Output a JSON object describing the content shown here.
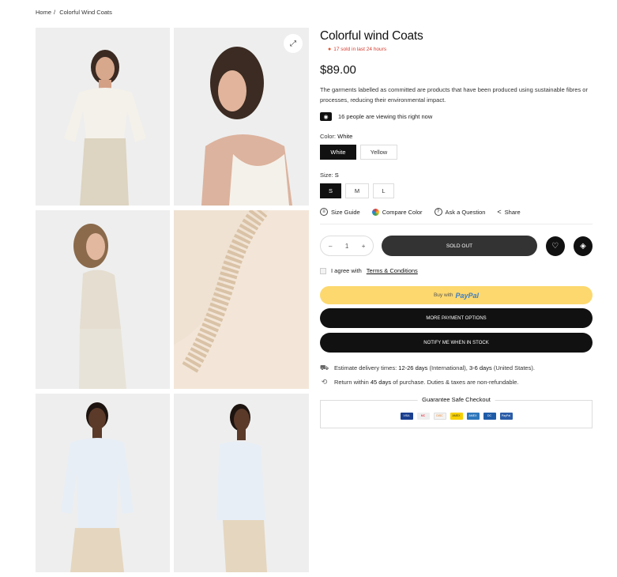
{
  "breadcrumb": {
    "home": "Home",
    "sep": "/",
    "current": "Colorful Wind Coats"
  },
  "product": {
    "title": "Colorful wind Coats",
    "sold_text": "17 sold in last 24 hours",
    "price": "$89.00",
    "description": "The garments labelled as committed are products that have been produced using sustainable fibres or processes, reducing their environmental impact.",
    "viewing_text": "16 people are viewing this right now"
  },
  "color": {
    "label": "Color:",
    "selected": "White",
    "options": [
      "White",
      "Yellow"
    ]
  },
  "size": {
    "label": "Size:",
    "selected": "S",
    "options": [
      "S",
      "M",
      "L"
    ]
  },
  "tools": [
    "Size Guide",
    "Compare Color",
    "Ask a Question",
    "Share"
  ],
  "purchase": {
    "qty_minus": "–",
    "qty_value": "1",
    "qty_plus": "+",
    "sold_out_label": "SOLD OUT",
    "agree_text": "I agree with",
    "terms_link": "Terms & Conditions",
    "paypal_prefix": "Buy with",
    "paypal_brand": "PayPal",
    "more_payment": "MORE PAYMENT OPTIONS",
    "notify": "NOTIFY ME WHEN IN STOCK"
  },
  "shipping": {
    "delivery_prefix": "Estimate delivery times:",
    "delivery_intl": "12-26 days",
    "delivery_intl_suffix": "(International),",
    "delivery_us": "3-6 days",
    "delivery_us_suffix": "(United States).",
    "return_prefix": "Return within",
    "return_days": "45 days",
    "return_suffix": "of purchase. Duties & taxes are non-refundable."
  },
  "checkout": {
    "title": "Guarantee Safe Checkout",
    "cards": [
      {
        "name": "VISA",
        "color": "#1a3f8f"
      },
      {
        "name": "MC",
        "color": "#eb001b"
      },
      {
        "name": "DISC",
        "color": "#f3f3f3"
      },
      {
        "name": "AMEX",
        "color": "#f7d000"
      },
      {
        "name": "AMEX",
        "color": "#2e77bb"
      },
      {
        "name": "DC",
        "color": "#1f5ca8"
      },
      {
        "name": "PayPal",
        "color": "#2b5da8"
      }
    ]
  },
  "icons": {
    "zoom": "expand-icon",
    "fire": "fire-icon",
    "eye": "eye-icon",
    "ruler": "ruler-icon",
    "palette": "color-wheel-icon",
    "question": "question-icon",
    "share": "share-icon",
    "heart": "heart-icon",
    "compare": "layers-icon",
    "truck": "truck-icon",
    "return": "return-icon"
  }
}
